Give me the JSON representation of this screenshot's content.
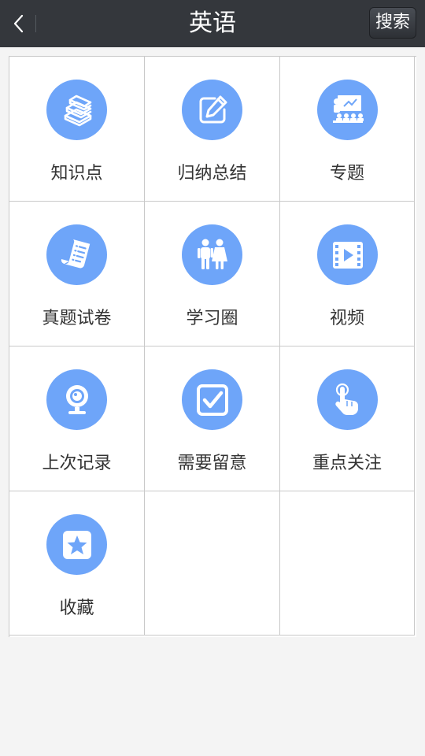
{
  "header": {
    "title": "英语",
    "search_label": "搜索",
    "back_icon": "chevron-left-icon"
  },
  "accent_color": "#6ea5f9",
  "tiles": [
    {
      "label": "知识点",
      "icon": "books-icon"
    },
    {
      "label": "归纳总结",
      "icon": "edit-icon"
    },
    {
      "label": "专题",
      "icon": "presentation-icon"
    },
    {
      "label": "真题试卷",
      "icon": "scroll-icon"
    },
    {
      "label": "学习圈",
      "icon": "people-icon"
    },
    {
      "label": "视频",
      "icon": "film-icon"
    },
    {
      "label": "上次记录",
      "icon": "webcam-icon"
    },
    {
      "label": "需要留意",
      "icon": "checkbox-icon"
    },
    {
      "label": "重点关注",
      "icon": "tap-icon"
    },
    {
      "label": "收藏",
      "icon": "star-icon"
    }
  ]
}
